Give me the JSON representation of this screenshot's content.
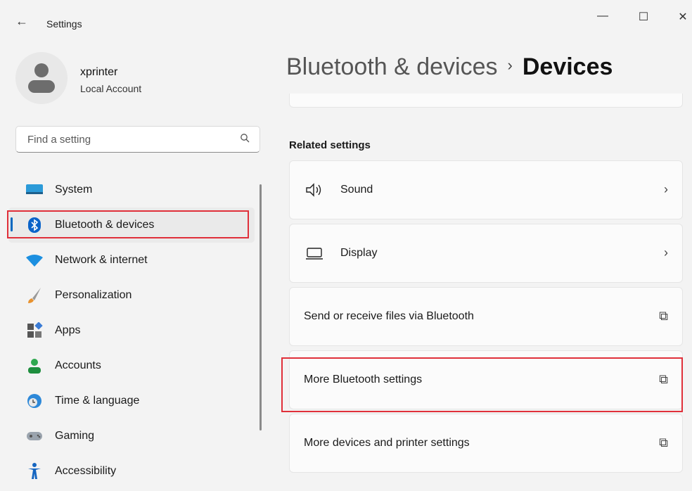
{
  "window": {
    "title": "Settings",
    "back_glyph": "←",
    "minimize": "—",
    "maximize": "☐",
    "close": "✕"
  },
  "profile": {
    "name": "xprinter",
    "type": "Local Account"
  },
  "search": {
    "placeholder": "Find a setting"
  },
  "nav": {
    "items": [
      {
        "label": "System",
        "icon": "system-icon"
      },
      {
        "label": "Bluetooth & devices",
        "icon": "bluetooth-icon",
        "active": true
      },
      {
        "label": "Network & internet",
        "icon": "wifi-icon"
      },
      {
        "label": "Personalization",
        "icon": "brush-icon"
      },
      {
        "label": "Apps",
        "icon": "apps-icon"
      },
      {
        "label": "Accounts",
        "icon": "account-icon"
      },
      {
        "label": "Time & language",
        "icon": "globe-clock-icon"
      },
      {
        "label": "Gaming",
        "icon": "controller-icon"
      },
      {
        "label": "Accessibility",
        "icon": "accessibility-icon"
      }
    ]
  },
  "breadcrumb": {
    "parent": "Bluetooth & devices",
    "separator": "›",
    "current": "Devices"
  },
  "related": {
    "heading": "Related settings",
    "items": [
      {
        "label": "Sound",
        "icon": "speaker-icon",
        "trail": "›"
      },
      {
        "label": "Display",
        "icon": "monitor-icon",
        "trail": "›"
      },
      {
        "label": "Send or receive files via Bluetooth",
        "trail": "⧉"
      },
      {
        "label": "More Bluetooth settings",
        "trail": "⧉"
      },
      {
        "label": "More devices and printer settings",
        "trail": "⧉"
      }
    ]
  },
  "colors": {
    "accent": "#0067c0",
    "highlight": "#e0303a"
  }
}
